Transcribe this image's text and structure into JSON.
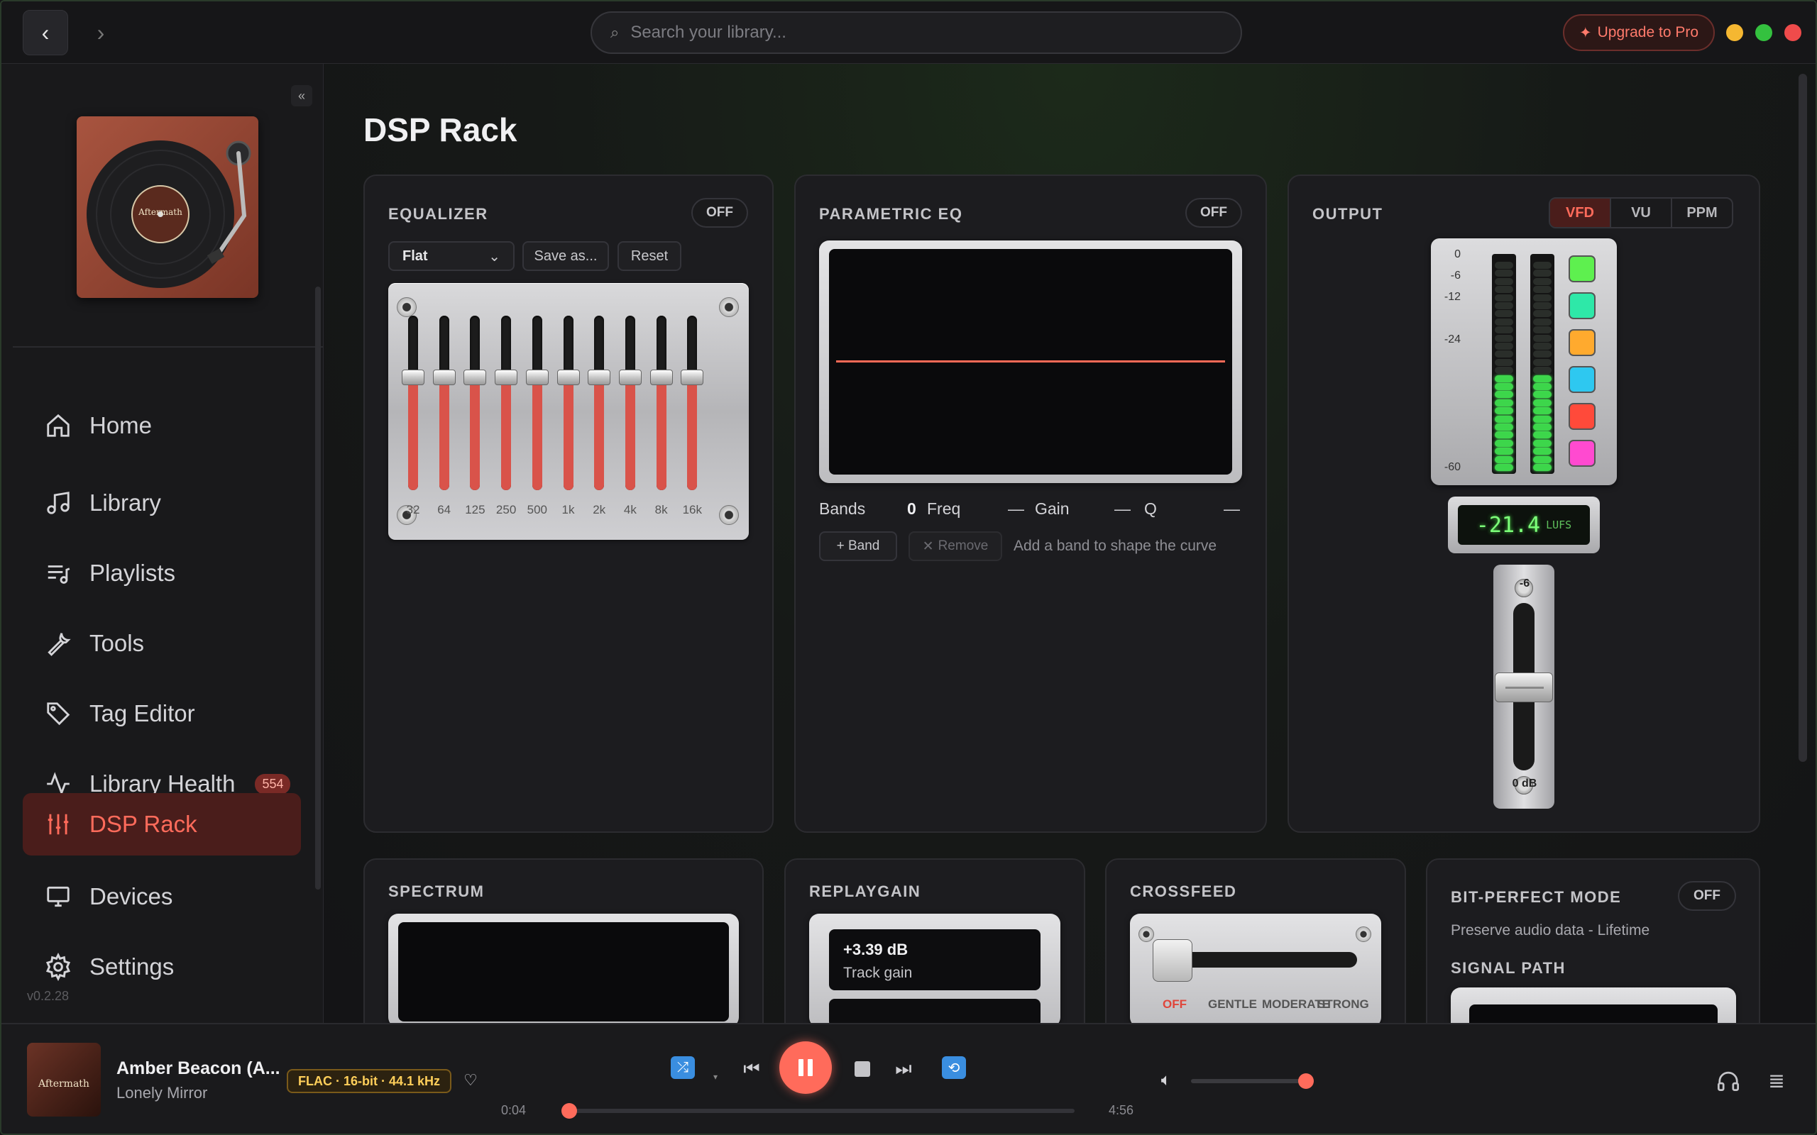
{
  "topbar": {
    "search_placeholder": "Search your library...",
    "upgrade_label": "Upgrade to Pro",
    "colors": {
      "accent": "#ff6b5b",
      "traffic_min": "#f5b731",
      "traffic_max": "#34c13f",
      "traffic_close": "#ef4b4b"
    }
  },
  "sidebar": {
    "items": [
      {
        "label": "Home",
        "icon": "home-icon"
      },
      {
        "label": "Library",
        "icon": "music-note-icon"
      },
      {
        "label": "Playlists",
        "icon": "playlist-icon"
      },
      {
        "label": "Tools",
        "icon": "wrench-icon"
      },
      {
        "label": "Tag Editor",
        "icon": "tag-icon"
      },
      {
        "label": "Library Health",
        "icon": "pulse-icon",
        "badge": "554"
      },
      {
        "label": "DSP Rack",
        "icon": "sliders-icon",
        "active": true
      },
      {
        "label": "Devices",
        "icon": "monitor-icon"
      },
      {
        "label": "Settings",
        "icon": "gear-icon"
      }
    ],
    "cover_text": "Aftermath",
    "version": "v0.2.28"
  },
  "page": {
    "title": "DSP Rack"
  },
  "equalizer": {
    "title": "EQUALIZER",
    "toggle": "OFF",
    "preset": "Flat",
    "save_label": "Save as...",
    "reset_label": "Reset",
    "bands": [
      "32",
      "64",
      "125",
      "250",
      "500",
      "1k",
      "2k",
      "4k",
      "8k",
      "16k"
    ],
    "gains_db": [
      0,
      0,
      0,
      0,
      0,
      0,
      0,
      0,
      0,
      0
    ]
  },
  "parametric_eq": {
    "title": "PARAMETRIC EQ",
    "toggle": "OFF",
    "bands_label": "Bands",
    "bands_value": "0",
    "freq_label": "Freq",
    "freq_value": "—",
    "gain_label": "Gain",
    "gain_value": "—",
    "q_label": "Q",
    "q_value": "—",
    "add_band": "+ Band",
    "remove": "Remove",
    "hint": "Add a band to shape the curve"
  },
  "output": {
    "title": "OUTPUT",
    "modes": [
      "VFD",
      "VU",
      "PPM"
    ],
    "active_mode": "VFD",
    "scale": [
      "0",
      "-6",
      "-12",
      "-24",
      "-60"
    ],
    "level_fraction": 0.47,
    "swatches": [
      "#5ef04f",
      "#2ee8a8",
      "#ffaa2e",
      "#2ec8f0",
      "#ff4a3a",
      "#ff4ad0"
    ],
    "lufs_value": "-21.4",
    "lufs_unit": "LUFS",
    "volume_top_label": "-6",
    "volume_bottom_label": "0 dB"
  },
  "spectrum": {
    "title": "SPECTRUM"
  },
  "replaygain": {
    "title": "REPLAYGAIN",
    "value": "+3.39 dB",
    "label": "Track gain"
  },
  "crossfeed": {
    "title": "CROSSFEED",
    "levels": [
      "OFF",
      "GENTLE",
      "MODERATE",
      "STRONG"
    ],
    "active": "OFF"
  },
  "bitperfect": {
    "title": "BIT-PERFECT MODE",
    "toggle": "OFF",
    "description": "Preserve audio data - Lifetime",
    "signal_path": "SIGNAL PATH"
  },
  "player": {
    "title": "Amber Beacon (A...",
    "artist": "Lonely Mirror",
    "format": "FLAC · 16-bit · 44.1 kHz",
    "elapsed": "0:04",
    "duration": "4:56",
    "progress_fraction": 0.014,
    "volume_fraction": 0.95
  }
}
